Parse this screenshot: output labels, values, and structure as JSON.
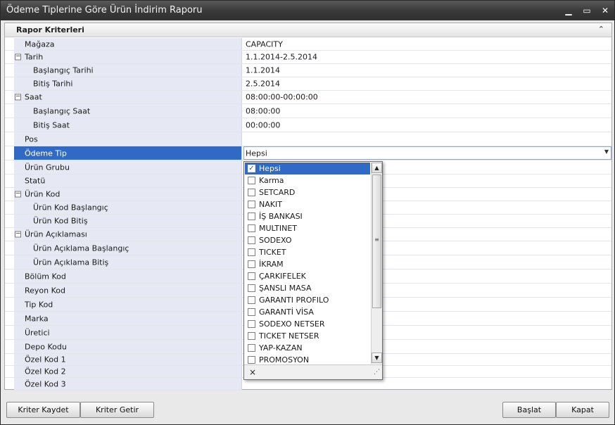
{
  "window": {
    "title": "Ödeme Tiplerine Göre Ürün İndirim Raporu",
    "minimize_glyph": "▁",
    "maximize_glyph": "▭",
    "close_glyph": "✕"
  },
  "panel": {
    "title": "Rapor Kriterleri",
    "collapse_glyph": "⌃"
  },
  "criteria": [
    {
      "label": "Mağaza",
      "value": "CAPACITY",
      "level": 0,
      "expandable": false
    },
    {
      "label": "Tarih",
      "value": "1.1.2014-2.5.2014",
      "level": 0,
      "expandable": true
    },
    {
      "label": "Başlangıç Tarihi",
      "value": "1.1.2014",
      "level": 1,
      "expandable": false
    },
    {
      "label": "Bitiş Tarihi",
      "value": "2.5.2014",
      "level": 1,
      "expandable": false
    },
    {
      "label": "Saat",
      "value": "08:00:00-00:00:00",
      "level": 0,
      "expandable": true
    },
    {
      "label": "Başlangıç Saat",
      "value": "08:00:00",
      "level": 1,
      "expandable": false
    },
    {
      "label": "Bitiş Saat",
      "value": "00:00:00",
      "level": 1,
      "expandable": false
    },
    {
      "label": "Pos",
      "value": "",
      "level": 0,
      "expandable": false
    },
    {
      "label": "Ödeme Tip",
      "value": "Hepsi",
      "level": 0,
      "expandable": false,
      "selected": true
    },
    {
      "label": "Ürün Grubu",
      "value": "",
      "level": 0,
      "expandable": false
    },
    {
      "label": "Statü",
      "value": "",
      "level": 0,
      "expandable": false
    },
    {
      "label": "Ürün Kod",
      "value": "",
      "level": 0,
      "expandable": true
    },
    {
      "label": "Ürün Kod Başlangıç",
      "value": "",
      "level": 1,
      "expandable": false
    },
    {
      "label": "Ürün Kod Bitiş",
      "value": "",
      "level": 1,
      "expandable": false
    },
    {
      "label": "Ürün Açıklaması",
      "value": "",
      "level": 0,
      "expandable": true
    },
    {
      "label": "Ürün Açıklama Başlangıç",
      "value": "",
      "level": 1,
      "expandable": false
    },
    {
      "label": "Ürün Açıklama Bitiş",
      "value": "",
      "level": 1,
      "expandable": false
    },
    {
      "label": "Bölüm Kod",
      "value": "",
      "level": 0,
      "expandable": false
    },
    {
      "label": "Reyon Kod",
      "value": "",
      "level": 0,
      "expandable": false
    },
    {
      "label": "Tip Kod",
      "value": "",
      "level": 0,
      "expandable": false
    },
    {
      "label": "Marka",
      "value": "",
      "level": 0,
      "expandable": false
    },
    {
      "label": "Üretici",
      "value": "",
      "level": 0,
      "expandable": false
    },
    {
      "label": "Depo Kodu",
      "value": "",
      "level": 0,
      "expandable": false
    },
    {
      "label": "Özel Kod 1",
      "value": "",
      "level": 0,
      "expandable": false
    },
    {
      "label": "Özel Kod 2",
      "value": "",
      "level": 0,
      "expandable": false
    },
    {
      "label": "Özel Kod 3",
      "value": "",
      "level": 0,
      "expandable": false
    }
  ],
  "expand_glyph": "−",
  "dropdown_arrow": "▼",
  "payment_dropdown": {
    "items": [
      {
        "label": "Hepsi",
        "checked": true,
        "active": true
      },
      {
        "label": "Karma",
        "checked": false
      },
      {
        "label": "SETCARD",
        "checked": false
      },
      {
        "label": "NAKIT",
        "checked": false
      },
      {
        "label": "İŞ BANKASI",
        "checked": false
      },
      {
        "label": "MULTINET",
        "checked": false
      },
      {
        "label": "SODEXO",
        "checked": false
      },
      {
        "label": "TICKET",
        "checked": false
      },
      {
        "label": "İKRAM",
        "checked": false
      },
      {
        "label": "ÇARKIFELEK",
        "checked": false
      },
      {
        "label": "ŞANSLI MASA",
        "checked": false
      },
      {
        "label": "GARANTI PROFILO",
        "checked": false
      },
      {
        "label": "GARANTİ VİSA",
        "checked": false
      },
      {
        "label": "SODEXO NETSER",
        "checked": false
      },
      {
        "label": "TICKET NETSER",
        "checked": false
      },
      {
        "label": "YAP-KAZAN",
        "checked": false
      },
      {
        "label": "PROMOSYON",
        "checked": false
      }
    ],
    "check_glyph": "✓",
    "scroll_up_glyph": "▲",
    "scroll_down_glyph": "▼",
    "grip_glyph": "≡",
    "clear_glyph": "×",
    "resize_glyph": "⋰"
  },
  "buttons": {
    "save_criteria": "Kriter Kaydet",
    "load_criteria": "Kriter Getir",
    "start": "Başlat",
    "close": "Kapat"
  }
}
